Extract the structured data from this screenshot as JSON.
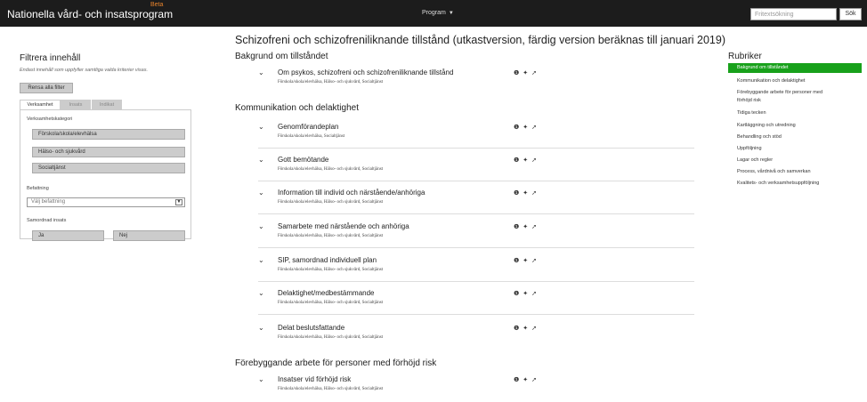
{
  "header": {
    "brand": "Nationella vård- och insatsprogram",
    "beta": "Beta",
    "program_menu": "Program",
    "program_caret": "▼",
    "search_placeholder": "Fritextsökning",
    "search_button": "Sök"
  },
  "filter": {
    "title": "Filtrera innehåll",
    "note": "Endast innehåll som uppfyller samtliga valda kriterier visas.",
    "reset": "Rensa alla filter",
    "tabs": [
      "Verksamhet",
      "Insats",
      "Indikat"
    ],
    "category_label": "Verksamhetskategori",
    "categories": [
      "Förskola/skola/elevhälsa",
      "Hälso- och sjukvård",
      "Socialtjänst"
    ],
    "role_label": "Befattning",
    "role_placeholder": "Välj befattning",
    "coord_label": "Samordnad insats",
    "coord_yes": "Ja",
    "coord_no": "Nej"
  },
  "main": {
    "title": "Schizofreni och schizofreniliknande tillstånd (utkastversion, färdig version beräknas till januari 2019)",
    "sections": [
      {
        "heading": "Bakgrund om tillståndet",
        "items": [
          {
            "title": "Om psykos, schizofreni och schizofreniliknande tillstånd",
            "sub": "Förskola/skola/elevhälsa, Hälso- och sjukvård, Socialtjänst"
          }
        ]
      },
      {
        "heading": "Kommunikation och delaktighet",
        "items": [
          {
            "title": "Genomförandeplan",
            "sub": "Förskola/skola/elevhälsa, Socialtjänst"
          },
          {
            "title": "Gott bemötande",
            "sub": "Förskola/skola/elevhälsa, Hälso- och sjukvård, Socialtjänst"
          },
          {
            "title": "Information till individ och närstående/anhöriga",
            "sub": "Förskola/skola/elevhälsa, Hälso- och sjukvård, Socialtjänst"
          },
          {
            "title": "Samarbete med närstående och anhöriga",
            "sub": "Förskola/skola/elevhälsa, Hälso- och sjukvård, Socialtjänst"
          },
          {
            "title": "SIP, samordnad individuell plan",
            "sub": "Förskola/skola/elevhälsa, Hälso- och sjukvård, Socialtjänst"
          },
          {
            "title": "Delaktighet/medbestämmande",
            "sub": "Förskola/skola/elevhälsa, Hälso- och sjukvård, Socialtjänst"
          },
          {
            "title": "Delat beslutsfattande",
            "sub": "Förskola/skola/elevhälsa, Hälso- och sjukvård, Socialtjänst"
          }
        ]
      },
      {
        "heading": "Förebyggande arbete för personer med förhöjd risk",
        "items": [
          {
            "title": "Insatser vid förhöjd risk",
            "sub": "Förskola/skola/elevhälsa, Hälso- och sjukvård, Socialtjänst"
          }
        ]
      }
    ],
    "item_icons": [
      "info-icon",
      "pin-icon",
      "share-icon"
    ]
  },
  "rubriker": {
    "title": "Rubriker",
    "items": [
      "Bakgrund om tillståndet",
      "Kommunikation och delaktighet",
      "Förebyggande arbete för personer med",
      "förhöjd risk",
      "Tidiga tecken",
      "Kartläggning och utredning",
      "Behandling och stöd",
      "Uppföljning",
      "Lagar och regler",
      "Process, vårdnivå och samverkan",
      "Kvalitets- och verksamhetsuppföljning"
    ]
  },
  "colors": {
    "topbar": "#1c1c1c",
    "beta": "#e8842c",
    "active": "#18a11b"
  }
}
